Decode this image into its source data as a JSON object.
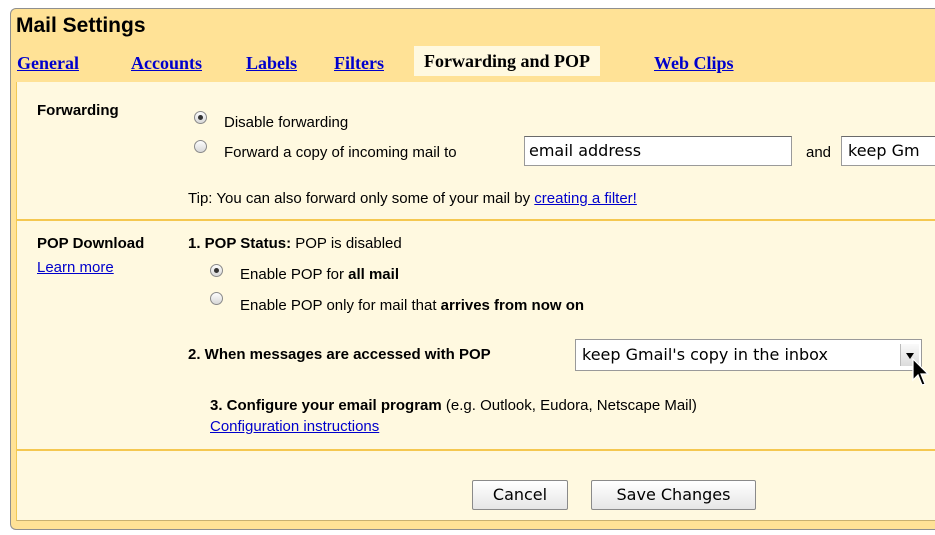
{
  "window_title": "Mail Settings",
  "tabs": [
    {
      "label": "General"
    },
    {
      "label": "Accounts"
    },
    {
      "label": "Labels"
    },
    {
      "label": "Filters"
    },
    {
      "label": "Forwarding and POP",
      "active": true
    },
    {
      "label": "Web Clips"
    }
  ],
  "forwarding": {
    "heading": "Forwarding",
    "option_disable": "Disable forwarding",
    "option_forward": "Forward a copy of incoming mail to",
    "email_placeholder": "email address",
    "and_label": "and",
    "action_value": "keep Gm",
    "tip_prefix": "Tip: You can also forward only some of your mail by ",
    "tip_link": "creating a filter!",
    "selected": "disable"
  },
  "pop": {
    "heading": "POP Download",
    "learn_more": "Learn more",
    "status_label": "1. POP Status:",
    "status_value": " POP is disabled",
    "option_all_prefix": "Enable POP for ",
    "option_all_bold": "all mail",
    "option_now_prefix": "Enable POP only for mail that ",
    "option_now_bold": "arrives from now on",
    "selected": "all",
    "step2_label": "2. When messages are accessed with POP",
    "step2_value": "keep Gmail's copy in the inbox",
    "step3_label": "3. Configure your email program",
    "step3_hint": " (e.g. Outlook, Eudora, Netscape Mail)",
    "step3_link": "Configuration instructions"
  },
  "buttons": {
    "cancel": "Cancel",
    "save": "Save Changes"
  },
  "colors": {
    "panel": "#ffe296",
    "content": "#fff9e0",
    "divider": "#f5c850",
    "link": "#0000cc"
  },
  "icons": {
    "cursor": "arrow-cursor-icon"
  }
}
